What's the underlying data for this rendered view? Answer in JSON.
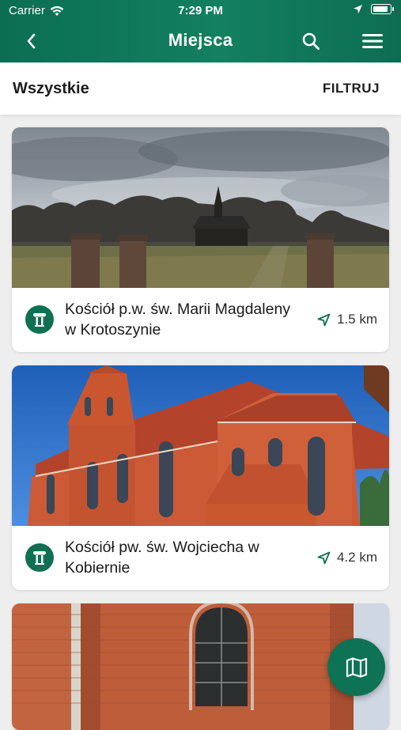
{
  "status": {
    "carrier": "Carrier",
    "time": "7:29 PM"
  },
  "header": {
    "title": "Miejsca"
  },
  "filter": {
    "title": "Wszystkie",
    "button": "FILTRUJ"
  },
  "places": [
    {
      "name": "Kościół p.w. św. Marii Magdaleny w Krotoszynie",
      "distance": "1.5 km",
      "icon": "column-icon"
    },
    {
      "name": "Kościół pw. św. Wojciecha w Kobiernie",
      "distance": "4.2 km",
      "icon": "column-icon"
    },
    {
      "name": "",
      "distance": "",
      "icon": "column-icon"
    }
  ],
  "colors": {
    "primary": "#0f7054",
    "fab": "#0e7254"
  },
  "fab": {
    "icon": "map-icon"
  }
}
